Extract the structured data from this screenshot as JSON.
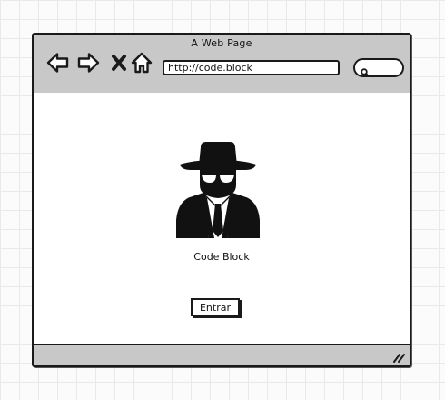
{
  "window": {
    "title": "A Web Page"
  },
  "toolbar": {
    "back_icon": "back-arrow-icon",
    "forward_icon": "forward-arrow-icon",
    "stop_icon": "close-x-icon",
    "home_icon": "home-icon",
    "address_value": "http://code.block",
    "search_icon": "search-icon"
  },
  "main": {
    "logo_icon": "spy-icon",
    "logo_label": "Code Block",
    "enter_button_label": "Entrar"
  },
  "statusbar": {
    "resize_icon": "resize-grip-icon"
  },
  "colors": {
    "chrome": "#c8c8c8",
    "ink": "#1a1a1a",
    "page": "#ffffff"
  }
}
